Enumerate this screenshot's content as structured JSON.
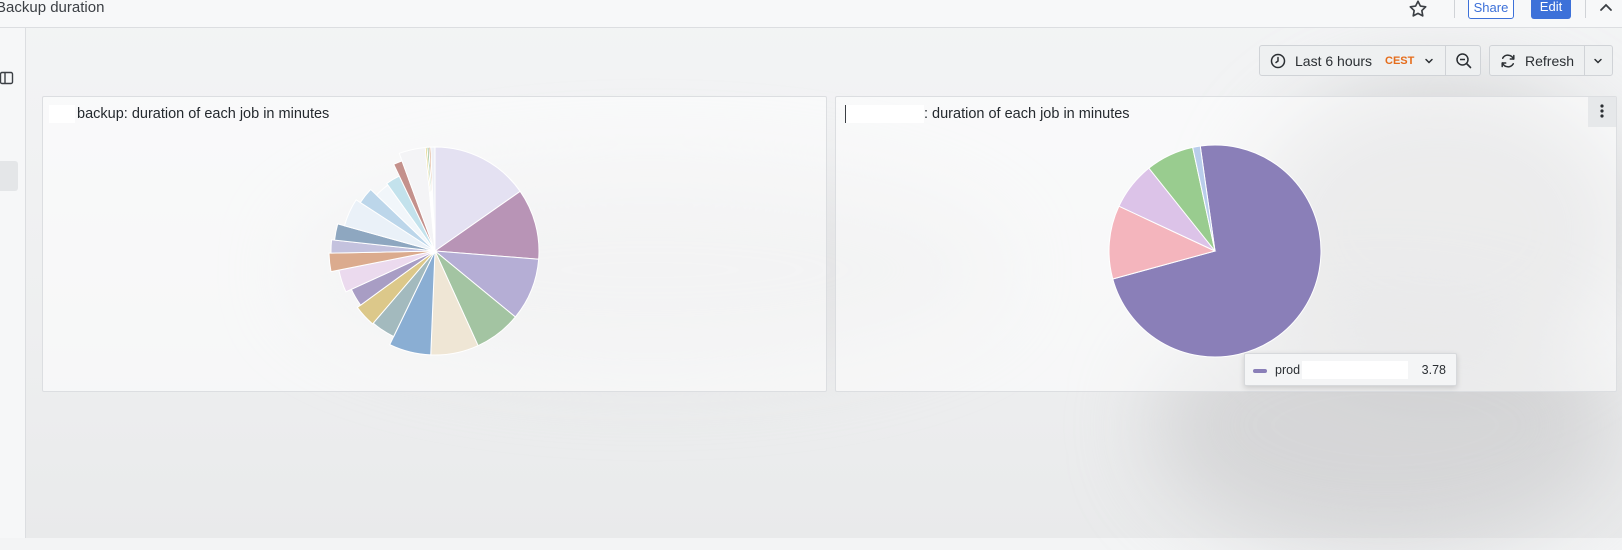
{
  "dashboard": {
    "title": "Backup duration",
    "share_label": "Share",
    "edit_label": "Edit"
  },
  "toolbar": {
    "time_range_label": "Last 6 hours",
    "timezone_label": "CEST",
    "refresh_label": "Refresh"
  },
  "icons": {
    "star": "star-icon",
    "collapse": "chevron-up-icon",
    "dock": "dock-menu-icon",
    "clock": "clock-icon",
    "zoom_out": "zoom-out-icon",
    "refresh": "refresh-icon",
    "menu": "kebab-menu-icon"
  },
  "colors": {
    "accent": "#3d71d9",
    "timezone": "#e56c1b"
  },
  "panels": [
    {
      "title": "backup: duration of each job in minutes"
    },
    {
      "title": ": duration of each job in minutes"
    }
  ],
  "tooltip": {
    "series_name": "prod",
    "value": "3.78",
    "color": "#8a7fb8"
  },
  "chart_data": [
    {
      "type": "pie",
      "series": [
        {
          "color": "#e4e1f2",
          "value": 8.2
        },
        {
          "color": "#b894b6",
          "value": 5.9
        },
        {
          "color": "#b5aed5",
          "value": 5.2
        },
        {
          "color": "#a3c4a2",
          "value": 3.9
        },
        {
          "color": "#efe6d5",
          "value": 4.0
        },
        {
          "color": "#8aaed3",
          "value": 3.5
        },
        {
          "color": "#a3babe",
          "value": 2.2
        },
        {
          "color": "#dcc88a",
          "value": 2.0
        },
        {
          "color": "#a89dc4",
          "value": 1.7
        },
        {
          "color": "#ebdaee",
          "value": 2.0
        },
        {
          "color": "#dbab8e",
          "value": 1.5
        },
        {
          "color": "#c4c2de",
          "value": 1.1
        },
        {
          "color": "#8ea7c0",
          "value": 1.4
        },
        {
          "color": "#eaf1f8",
          "value": 2.6
        },
        {
          "color": "#bcd6ea",
          "value": 1.6
        },
        {
          "color": "#f1f6fa",
          "value": 1.6
        },
        {
          "color": "#c3e2ec",
          "value": 1.5
        },
        {
          "color": "#c4918c",
          "value": 0.8
        },
        {
          "color": "#f4f4f6",
          "value": 2.2
        },
        {
          "color": "#e0d17e",
          "value": 0.15
        },
        {
          "color": "#87b78a",
          "value": 0.15
        },
        {
          "color": "#d9a07a",
          "value": 0.15
        },
        {
          "color": "#eef0f6",
          "value": 0.35
        }
      ]
    },
    {
      "type": "pie",
      "series": [
        {
          "name": "prod",
          "color": "#8a7fb8",
          "value": 3.78
        },
        {
          "color": "#f4b5bd",
          "value": 0.58
        },
        {
          "color": "#dcc3e8",
          "value": 0.38
        },
        {
          "color": "#99cc8f",
          "value": 0.38
        },
        {
          "color": "#b9cdeb",
          "value": 0.06
        }
      ]
    }
  ]
}
